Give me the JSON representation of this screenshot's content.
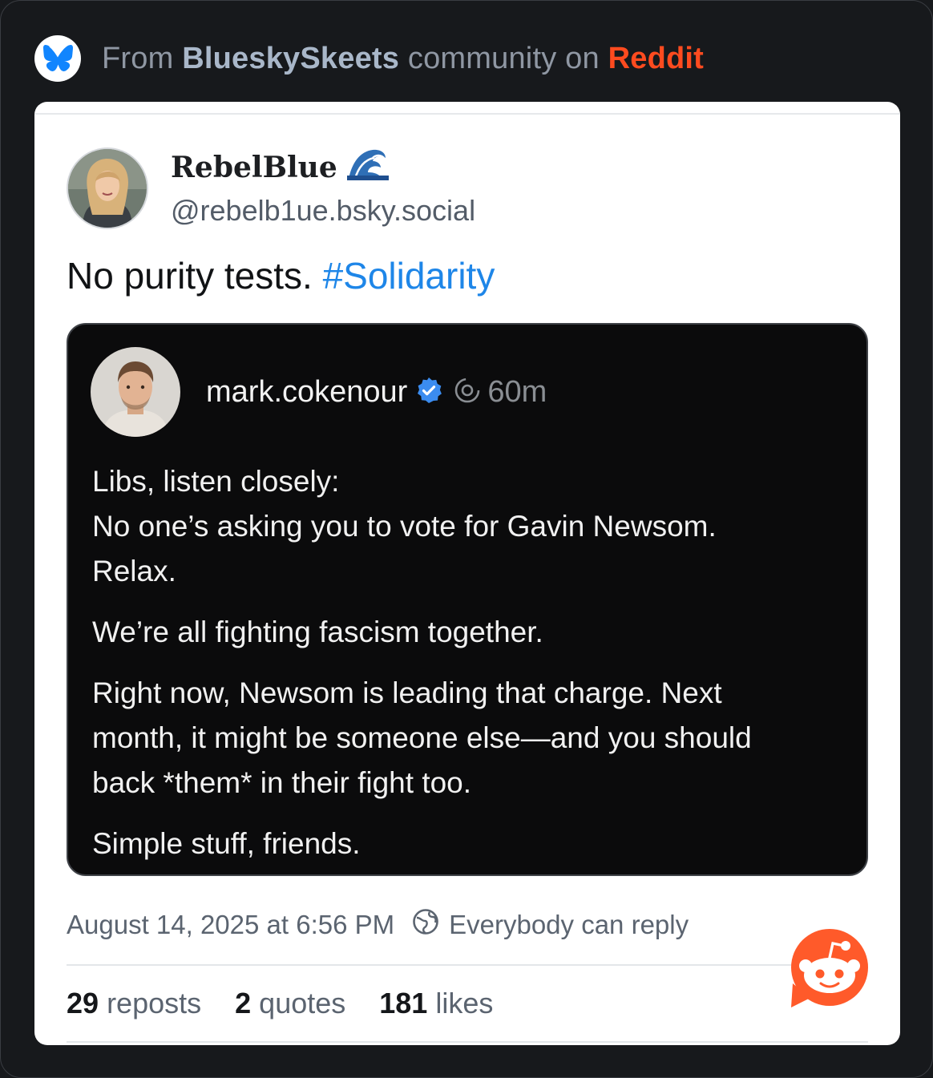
{
  "header": {
    "prefix": "From",
    "community": "BlueskySkeets",
    "middle": "community on",
    "platform": "Reddit",
    "logo_icon": "butterfly-icon"
  },
  "post": {
    "display_name": "RebelBlue",
    "name_emoji": "wave-emoji-icon",
    "handle": "@rebelb1ue.bsky.social",
    "text": "No purity tests.",
    "hashtag": "#Solidarity",
    "timestamp": "August 14, 2025 at 6:56 PM",
    "reply_setting": "Everybody can reply",
    "stats": {
      "reposts_count": "29",
      "reposts_label": "reposts",
      "quotes_count": "2",
      "quotes_label": "quotes",
      "likes_count": "181",
      "likes_label": "likes"
    }
  },
  "quoted": {
    "username": "mark.cokenour",
    "time": "60m",
    "verified_icon": "verified-badge-icon",
    "lines": {
      "p1_l1": "Libs, listen closely:",
      "p1_l2": "No one’s asking you to vote for Gavin Newsom.",
      "p1_l3": "Relax.",
      "p2": "We’re all fighting fascism together.",
      "p3_l1": "Right now, Newsom is leading that charge. Next",
      "p3_l2": "month, it might be someone else—and you should",
      "p3_l3": "back *them* in their fight too.",
      "p4": "Simple stuff, friends."
    }
  },
  "colors": {
    "page_bg": "#17191c",
    "reddit": "#ff4b1f",
    "hashtag": "#1e86e8",
    "bluesky": "#1185fe",
    "verified": "#3b8cf0"
  }
}
